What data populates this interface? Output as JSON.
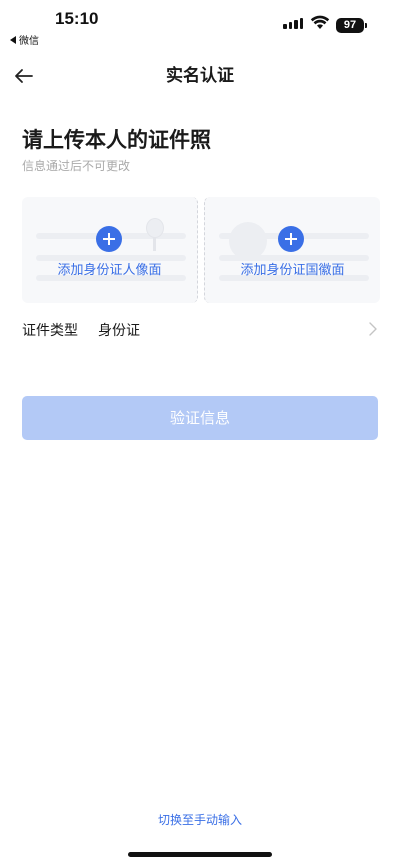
{
  "status_bar": {
    "time": "15:10",
    "back_app": "微信",
    "battery": "97"
  },
  "nav": {
    "title": "实名认证",
    "back_icon": "arrow-left-icon"
  },
  "header": {
    "title": "请上传本人的证件照",
    "subtitle": "信息通过后不可更改"
  },
  "upload": {
    "front_label": "添加身份证人像面",
    "back_label": "添加身份证国徽面",
    "accent": "#3a6fe6"
  },
  "cert_type": {
    "label": "证件类型",
    "value": "身份证"
  },
  "verify_button": {
    "label": "验证信息",
    "color": "#b3c9f6"
  },
  "switch_link": "切换至手动输入"
}
